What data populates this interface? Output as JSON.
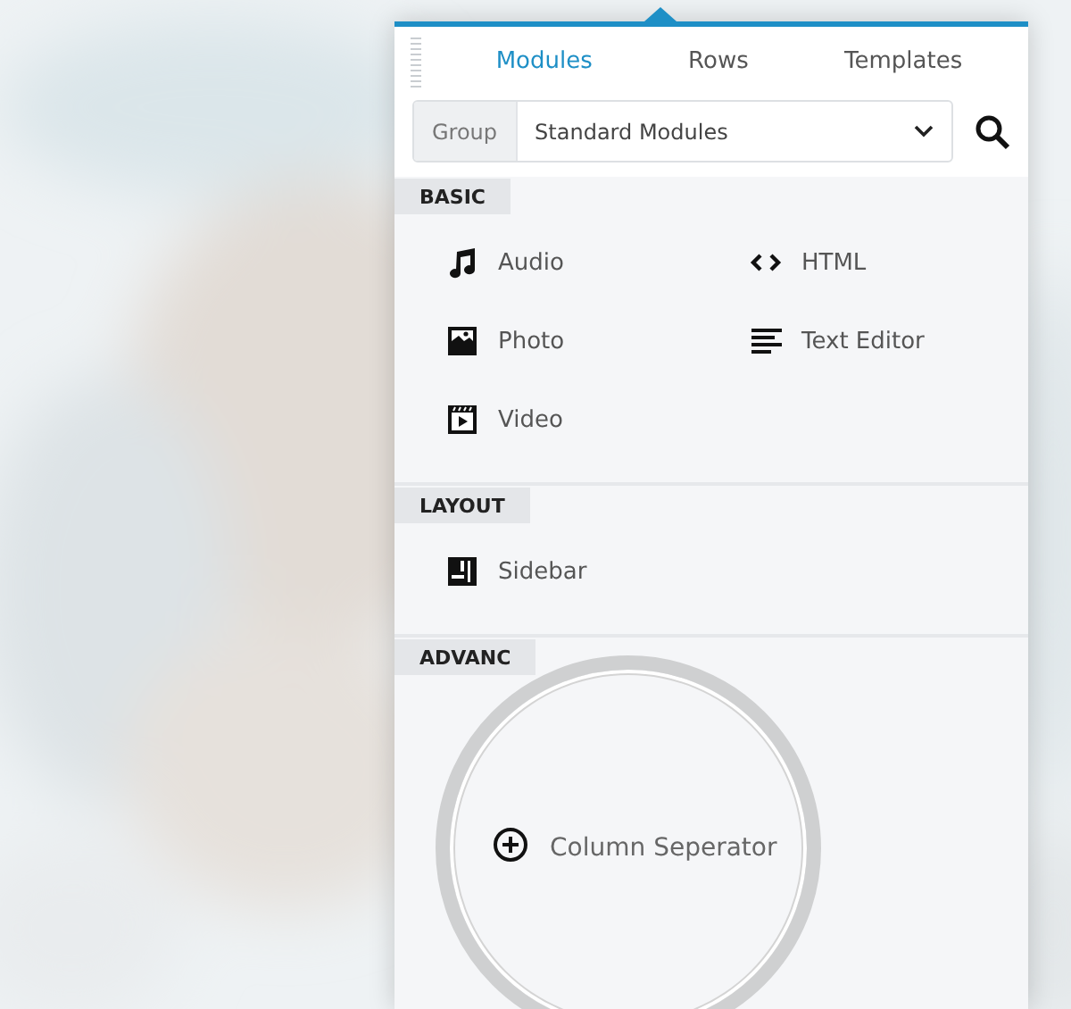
{
  "tabs": [
    {
      "label": "Modules",
      "selected": true
    },
    {
      "label": "Rows",
      "selected": false
    },
    {
      "label": "Templates",
      "selected": false
    }
  ],
  "group_filter": {
    "label": "Group",
    "value": "Standard Modules"
  },
  "sections": [
    {
      "title": "BASIC",
      "items": [
        {
          "label": "Audio",
          "kind": "music"
        },
        {
          "label": "HTML",
          "kind": "code"
        },
        {
          "label": "Photo"
        },
        {
          "label": "Text Editor",
          "kind": "text"
        },
        {
          "label": "Video",
          "kind": "video"
        }
      ]
    },
    {
      "title": "LAYOUT",
      "items": [
        {
          "label": "Sidebar",
          "kind": "sidebar"
        }
      ]
    },
    {
      "title": "ADVANC"
    }
  ],
  "magnified_item": {
    "label": "Column Seperator",
    "kind": "plus"
  }
}
